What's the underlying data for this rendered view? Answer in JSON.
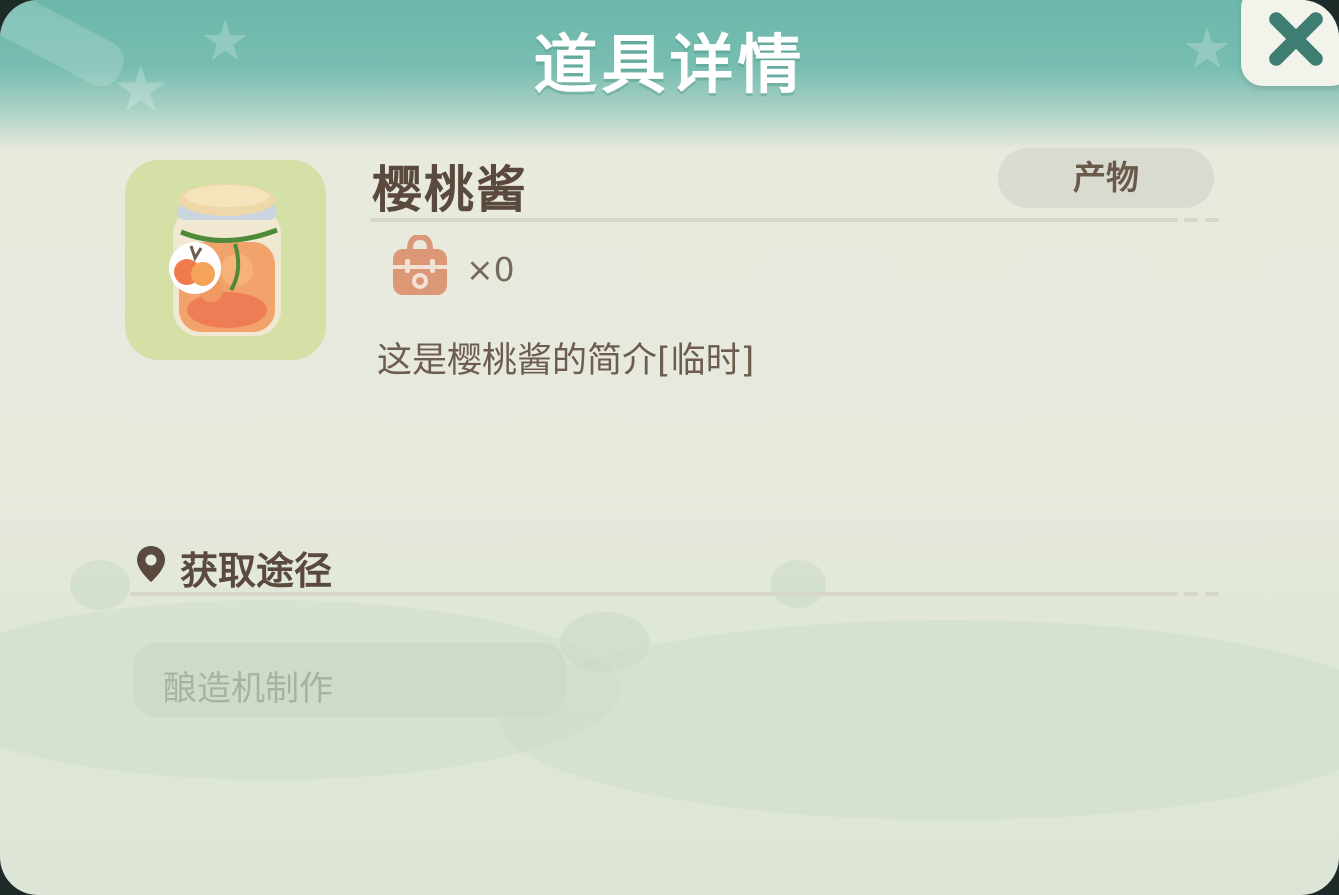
{
  "window": {
    "title": "道具详情"
  },
  "item": {
    "name": "樱桃酱",
    "category": "产物",
    "count_text": "×0",
    "description": "这是樱桃酱的简介[临时]"
  },
  "source_section": {
    "title": "获取途径",
    "entries": [
      "酿造机制作"
    ]
  },
  "icons": {
    "close": "close-icon",
    "item": "cherry-jam-jar-icon",
    "backpack": "backpack-icon",
    "location": "location-pin-icon"
  },
  "colors": {
    "header": "#6cb7aa",
    "panel": "#e9eadf",
    "item_tile": "#d4e0a5",
    "text_dark": "#5a4a3d",
    "close_icon": "#3e7d72"
  }
}
